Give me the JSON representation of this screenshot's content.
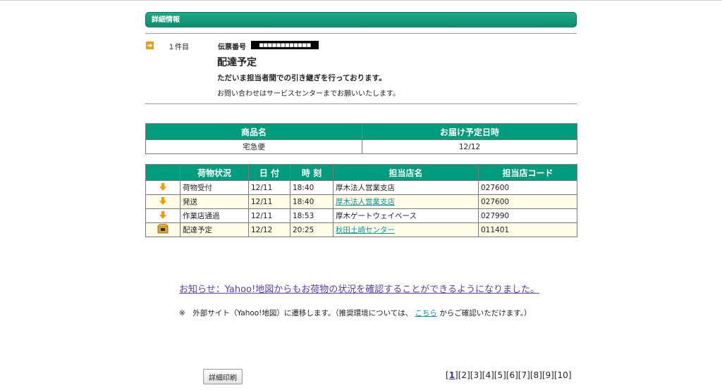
{
  "section": {
    "title": "詳細情報"
  },
  "item": {
    "count_label": "１件目",
    "slip_label": "伝票番号",
    "slip_value": "■■■■■■■■■■■■",
    "status_title": "配達予定",
    "status_message": "ただいま担当者間での引き継ぎを行っております。",
    "status_sub": "お問い合わせはサービスセンターまでお願いいたします。"
  },
  "summary": {
    "headers": [
      "商品名",
      "お届け予定日時"
    ],
    "row": [
      "宅急便",
      "12/12"
    ]
  },
  "tracking": {
    "headers": [
      "",
      "荷物状況",
      "日 付",
      "時 刻",
      "担当店名",
      "担当店コード"
    ],
    "rows": [
      {
        "status": "荷物受付",
        "date": "12/11",
        "time": "18:40",
        "store": "厚木法人営業支店",
        "code": "027600",
        "link": false,
        "icon": "down-arrow-icon"
      },
      {
        "status": "発送",
        "date": "12/11",
        "time": "18:40",
        "store": "厚木法人営業支店",
        "code": "027600",
        "link": true,
        "icon": "down-arrow-icon"
      },
      {
        "status": "作業店通過",
        "date": "12/11",
        "time": "18:53",
        "store": "厚木ゲートウェイベース",
        "code": "027990",
        "link": false,
        "icon": "down-arrow-icon"
      },
      {
        "status": "配達予定",
        "date": "12/12",
        "time": "20:25",
        "store": "秋田土崎センター",
        "code": "011401",
        "link": true,
        "icon": "package-box-icon"
      }
    ]
  },
  "notice": {
    "link_text": "お知らせ：Yahoo!地図からもお荷物の状況を確認することができるようになりました。",
    "note_prefix": "※　外部サイト（Yahoo!地図）に遷移します。（推奨環境については、",
    "note_link": "こちら",
    "note_suffix": "からご確認いただけます。）"
  },
  "actions": {
    "print_label": "詳細印刷"
  },
  "pager": {
    "current": "1",
    "pages": [
      "1",
      "2",
      "3",
      "4",
      "5",
      "6",
      "7",
      "8",
      "9",
      "10"
    ]
  },
  "colors": {
    "header_green": "#009a7c",
    "accent_orange": "#f39a00",
    "link": "#0a8fa0",
    "row_alt": "#fffde6"
  }
}
